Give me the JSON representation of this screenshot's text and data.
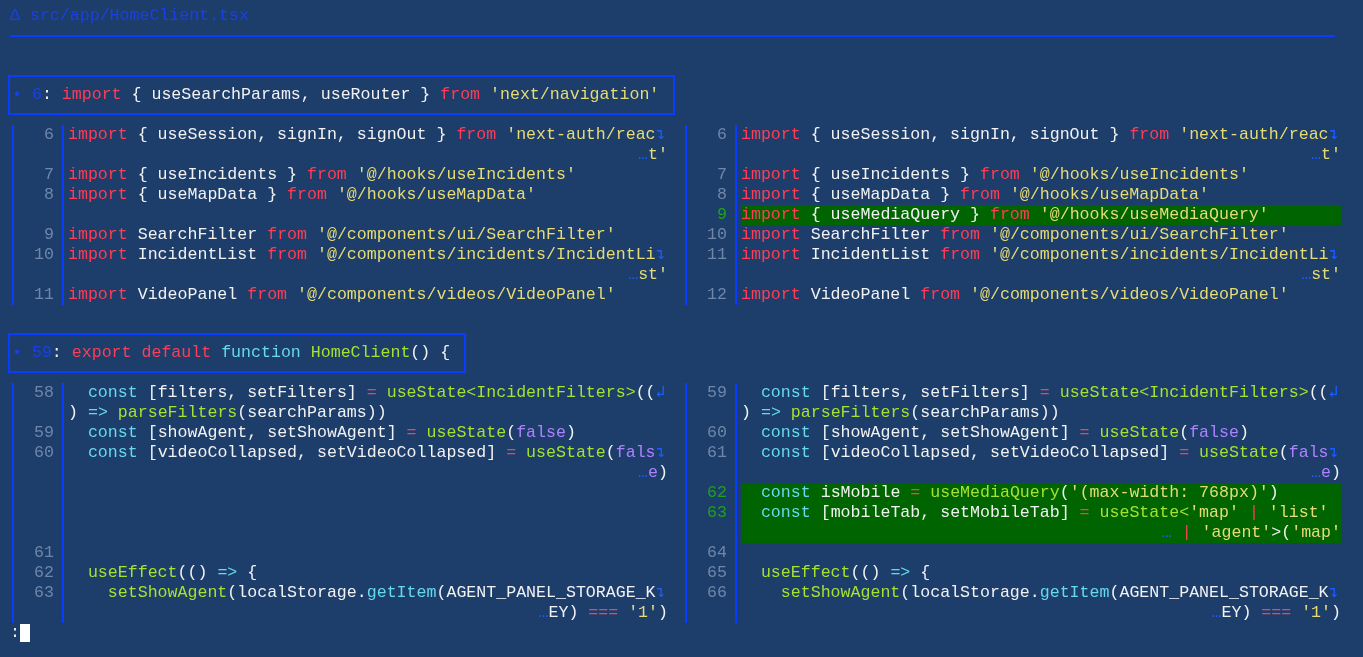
{
  "file_header": {
    "icon": "Δ",
    "path": "src/app/HomeClient.tsx"
  },
  "hunks": [
    {
      "header": {
        "bullet": "•",
        "line": "6",
        "sep": ":",
        "tokens": [
          {
            "kind": "kw",
            "text": "import"
          },
          {
            "kind": "plain",
            "text": " { useSearchParams, useRouter } "
          },
          {
            "kind": "kw",
            "text": "from"
          },
          {
            "kind": "str",
            "text": " 'next/navigation'"
          }
        ]
      },
      "left": [
        {
          "kind": "line",
          "num": "6",
          "added": false,
          "tokens": [
            {
              "kind": "kw",
              "text": "import"
            },
            {
              "kind": "plain",
              "text": " { useSession, signIn, signOut } "
            },
            {
              "kind": "kw",
              "text": "from"
            },
            {
              "kind": "str",
              "text": " 'next-auth/reac"
            },
            {
              "kind": "mark",
              "text": "↴"
            }
          ]
        },
        {
          "kind": "wrap",
          "right_aligned": true,
          "tokens": [
            {
              "kind": "mark",
              "text": "…"
            },
            {
              "kind": "str",
              "text": "t'"
            }
          ]
        },
        {
          "kind": "line",
          "num": "7",
          "added": false,
          "tokens": [
            {
              "kind": "kw",
              "text": "import"
            },
            {
              "kind": "plain",
              "text": " { useIncidents } "
            },
            {
              "kind": "kw",
              "text": "from"
            },
            {
              "kind": "str",
              "text": " '@/hooks/useIncidents'"
            }
          ]
        },
        {
          "kind": "line",
          "num": "8",
          "added": false,
          "tokens": [
            {
              "kind": "kw",
              "text": "import"
            },
            {
              "kind": "plain",
              "text": " { useMapData } "
            },
            {
              "kind": "kw",
              "text": "from"
            },
            {
              "kind": "str",
              "text": " '@/hooks/useMapData'"
            }
          ]
        },
        {
          "kind": "filler"
        },
        {
          "kind": "line",
          "num": "9",
          "added": false,
          "tokens": [
            {
              "kind": "kw",
              "text": "import"
            },
            {
              "kind": "plain",
              "text": " SearchFilter "
            },
            {
              "kind": "kw",
              "text": "from"
            },
            {
              "kind": "str",
              "text": " '@/components/ui/SearchFilter'"
            }
          ]
        },
        {
          "kind": "line",
          "num": "10",
          "added": false,
          "tokens": [
            {
              "kind": "kw",
              "text": "import"
            },
            {
              "kind": "plain",
              "text": " IncidentList "
            },
            {
              "kind": "kw",
              "text": "from"
            },
            {
              "kind": "str",
              "text": " '@/components/incidents/IncidentLi"
            },
            {
              "kind": "mark",
              "text": "↴"
            }
          ]
        },
        {
          "kind": "wrap",
          "right_aligned": true,
          "tokens": [
            {
              "kind": "mark",
              "text": "…"
            },
            {
              "kind": "str",
              "text": "st'"
            }
          ]
        },
        {
          "kind": "line",
          "num": "11",
          "added": false,
          "tokens": [
            {
              "kind": "kw",
              "text": "import"
            },
            {
              "kind": "plain",
              "text": " VideoPanel "
            },
            {
              "kind": "kw",
              "text": "from"
            },
            {
              "kind": "str",
              "text": " '@/components/videos/VideoPanel'"
            }
          ]
        }
      ],
      "right": [
        {
          "kind": "line",
          "num": "6",
          "added": false,
          "tokens": [
            {
              "kind": "kw",
              "text": "import"
            },
            {
              "kind": "plain",
              "text": " { useSession, signIn, signOut } "
            },
            {
              "kind": "kw",
              "text": "from"
            },
            {
              "kind": "str",
              "text": " 'next-auth/reac"
            },
            {
              "kind": "mark",
              "text": "↴"
            }
          ]
        },
        {
          "kind": "wrap",
          "right_aligned": true,
          "tokens": [
            {
              "kind": "mark",
              "text": "…"
            },
            {
              "kind": "str",
              "text": "t'"
            }
          ]
        },
        {
          "kind": "line",
          "num": "7",
          "added": false,
          "tokens": [
            {
              "kind": "kw",
              "text": "import"
            },
            {
              "kind": "plain",
              "text": " { useIncidents } "
            },
            {
              "kind": "kw",
              "text": "from"
            },
            {
              "kind": "str",
              "text": " '@/hooks/useIncidents'"
            }
          ]
        },
        {
          "kind": "line",
          "num": "8",
          "added": false,
          "tokens": [
            {
              "kind": "kw",
              "text": "import"
            },
            {
              "kind": "plain",
              "text": " { useMapData } "
            },
            {
              "kind": "kw",
              "text": "from"
            },
            {
              "kind": "str",
              "text": " '@/hooks/useMapData'"
            }
          ]
        },
        {
          "kind": "line",
          "num": "9",
          "added": true,
          "tokens": [
            {
              "kind": "kw",
              "text": "import"
            },
            {
              "kind": "plain",
              "text": " { useMediaQuery } "
            },
            {
              "kind": "kw",
              "text": "from"
            },
            {
              "kind": "str",
              "text": " '@/hooks/useMediaQuery'"
            }
          ]
        },
        {
          "kind": "line",
          "num": "10",
          "added": false,
          "tokens": [
            {
              "kind": "kw",
              "text": "import"
            },
            {
              "kind": "plain",
              "text": " SearchFilter "
            },
            {
              "kind": "kw",
              "text": "from"
            },
            {
              "kind": "str",
              "text": " '@/components/ui/SearchFilter'"
            }
          ]
        },
        {
          "kind": "line",
          "num": "11",
          "added": false,
          "tokens": [
            {
              "kind": "kw",
              "text": "import"
            },
            {
              "kind": "plain",
              "text": " IncidentList "
            },
            {
              "kind": "kw",
              "text": "from"
            },
            {
              "kind": "str",
              "text": " '@/components/incidents/IncidentLi"
            },
            {
              "kind": "mark",
              "text": "↴"
            }
          ]
        },
        {
          "kind": "wrap",
          "right_aligned": true,
          "tokens": [
            {
              "kind": "mark",
              "text": "…"
            },
            {
              "kind": "str",
              "text": "st'"
            }
          ]
        },
        {
          "kind": "line",
          "num": "12",
          "added": false,
          "tokens": [
            {
              "kind": "kw",
              "text": "import"
            },
            {
              "kind": "plain",
              "text": " VideoPanel "
            },
            {
              "kind": "kw",
              "text": "from"
            },
            {
              "kind": "str",
              "text": " '@/components/videos/VideoPanel'"
            }
          ]
        }
      ]
    },
    {
      "header": {
        "bullet": "•",
        "line": "59",
        "sep": ":",
        "tokens": [
          {
            "kind": "kw",
            "text": "export default"
          },
          {
            "kind": "storage",
            "text": " function"
          },
          {
            "kind": "fn",
            "text": " HomeClient"
          },
          {
            "kind": "plain",
            "text": "() {"
          }
        ]
      },
      "left": [
        {
          "kind": "line",
          "num": "58",
          "added": false,
          "tokens": [
            {
              "kind": "storage",
              "text": "  const"
            },
            {
              "kind": "plain",
              "text": " [filters, setFilters] "
            },
            {
              "kind": "kw",
              "text": "="
            },
            {
              "kind": "fn",
              "text": " useState<IncidentFilters>"
            },
            {
              "kind": "plain",
              "text": "(("
            },
            {
              "kind": "mark",
              "text": "↲"
            }
          ]
        },
        {
          "kind": "wrap",
          "right_aligned": false,
          "tokens": [
            {
              "kind": "plain",
              "text": ") "
            },
            {
              "kind": "storage",
              "text": "=>"
            },
            {
              "kind": "fn",
              "text": " parseFilters"
            },
            {
              "kind": "plain",
              "text": "(searchParams))"
            }
          ]
        },
        {
          "kind": "line",
          "num": "59",
          "added": false,
          "tokens": [
            {
              "kind": "storage",
              "text": "  const"
            },
            {
              "kind": "plain",
              "text": " [showAgent, setShowAgent] "
            },
            {
              "kind": "kw",
              "text": "="
            },
            {
              "kind": "fn",
              "text": " useState"
            },
            {
              "kind": "plain",
              "text": "("
            },
            {
              "kind": "bool",
              "text": "false"
            },
            {
              "kind": "plain",
              "text": ")"
            }
          ]
        },
        {
          "kind": "line",
          "num": "60",
          "added": false,
          "tokens": [
            {
              "kind": "storage",
              "text": "  const"
            },
            {
              "kind": "plain",
              "text": " [videoCollapsed, setVideoCollapsed] "
            },
            {
              "kind": "kw",
              "text": "="
            },
            {
              "kind": "fn",
              "text": " useState"
            },
            {
              "kind": "plain",
              "text": "("
            },
            {
              "kind": "bool",
              "text": "fals"
            },
            {
              "kind": "mark",
              "text": "↴"
            }
          ]
        },
        {
          "kind": "wrap",
          "right_aligned": true,
          "tokens": [
            {
              "kind": "mark",
              "text": "…"
            },
            {
              "kind": "bool",
              "text": "e"
            },
            {
              "kind": "plain",
              "text": ")"
            }
          ]
        },
        {
          "kind": "filler"
        },
        {
          "kind": "filler"
        },
        {
          "kind": "filler"
        },
        {
          "kind": "line",
          "num": "61",
          "added": false
        },
        {
          "kind": "line",
          "num": "62",
          "added": false,
          "tokens": [
            {
              "kind": "fn",
              "text": "  useEffect"
            },
            {
              "kind": "plain",
              "text": "(() "
            },
            {
              "kind": "storage",
              "text": "=>"
            },
            {
              "kind": "plain",
              "text": " {"
            }
          ]
        },
        {
          "kind": "line",
          "num": "63",
          "added": false,
          "tokens": [
            {
              "kind": "fn",
              "text": "    setShowAgent"
            },
            {
              "kind": "plain",
              "text": "(localStorage."
            },
            {
              "kind": "storage",
              "text": "getItem"
            },
            {
              "kind": "plain",
              "text": "(AGENT_PANEL_STORAGE_K"
            },
            {
              "kind": "mark",
              "text": "↴"
            }
          ]
        },
        {
          "kind": "wrap",
          "right_aligned": true,
          "tokens": [
            {
              "kind": "mark",
              "text": "…"
            },
            {
              "kind": "plain",
              "text": "EY) "
            },
            {
              "kind": "kw",
              "text": "==="
            },
            {
              "kind": "str",
              "text": " '1'"
            },
            {
              "kind": "plain",
              "text": ")"
            }
          ]
        }
      ],
      "right": [
        {
          "kind": "line",
          "num": "59",
          "added": false,
          "tokens": [
            {
              "kind": "storage",
              "text": "  const"
            },
            {
              "kind": "plain",
              "text": " [filters, setFilters] "
            },
            {
              "kind": "kw",
              "text": "="
            },
            {
              "kind": "fn",
              "text": " useState<IncidentFilters>"
            },
            {
              "kind": "plain",
              "text": "(("
            },
            {
              "kind": "mark",
              "text": "↲"
            }
          ]
        },
        {
          "kind": "wrap",
          "right_aligned": false,
          "tokens": [
            {
              "kind": "plain",
              "text": ") "
            },
            {
              "kind": "storage",
              "text": "=>"
            },
            {
              "kind": "fn",
              "text": " parseFilters"
            },
            {
              "kind": "plain",
              "text": "(searchParams))"
            }
          ]
        },
        {
          "kind": "line",
          "num": "60",
          "added": false,
          "tokens": [
            {
              "kind": "storage",
              "text": "  const"
            },
            {
              "kind": "plain",
              "text": " [showAgent, setShowAgent] "
            },
            {
              "kind": "kw",
              "text": "="
            },
            {
              "kind": "fn",
              "text": " useState"
            },
            {
              "kind": "plain",
              "text": "("
            },
            {
              "kind": "bool",
              "text": "false"
            },
            {
              "kind": "plain",
              "text": ")"
            }
          ]
        },
        {
          "kind": "line",
          "num": "61",
          "added": false,
          "tokens": [
            {
              "kind": "storage",
              "text": "  const"
            },
            {
              "kind": "plain",
              "text": " [videoCollapsed, setVideoCollapsed] "
            },
            {
              "kind": "kw",
              "text": "="
            },
            {
              "kind": "fn",
              "text": " useState"
            },
            {
              "kind": "plain",
              "text": "("
            },
            {
              "kind": "bool",
              "text": "fals"
            },
            {
              "kind": "mark",
              "text": "↴"
            }
          ]
        },
        {
          "kind": "wrap",
          "right_aligned": true,
          "tokens": [
            {
              "kind": "mark",
              "text": "…"
            },
            {
              "kind": "bool",
              "text": "e"
            },
            {
              "kind": "plain",
              "text": ")"
            }
          ]
        },
        {
          "kind": "line",
          "num": "62",
          "added": true,
          "tokens": [
            {
              "kind": "storage",
              "text": "  const"
            },
            {
              "kind": "plain",
              "text": " isMobile "
            },
            {
              "kind": "kw",
              "text": "="
            },
            {
              "kind": "fn",
              "text": " useMediaQuery"
            },
            {
              "kind": "plain",
              "text": "("
            },
            {
              "kind": "str",
              "text": "'(max-width: 768px)'"
            },
            {
              "kind": "plain",
              "text": ")"
            }
          ]
        },
        {
          "kind": "line",
          "num": "63",
          "added": true,
          "tokens": [
            {
              "kind": "storage",
              "text": "  const"
            },
            {
              "kind": "plain",
              "text": " [mobileTab, setMobileTab] "
            },
            {
              "kind": "kw",
              "text": "="
            },
            {
              "kind": "fn",
              "text": " useState<"
            },
            {
              "kind": "str",
              "text": "'map'"
            },
            {
              "kind": "kw",
              "text": " | "
            },
            {
              "kind": "str",
              "text": "'list'"
            }
          ]
        },
        {
          "kind": "wrap",
          "right_aligned": true,
          "added": true,
          "tokens": [
            {
              "kind": "mark",
              "text": "…"
            },
            {
              "kind": "kw",
              "text": " | "
            },
            {
              "kind": "str",
              "text": "'agent'"
            },
            {
              "kind": "plain",
              "text": ">("
            },
            {
              "kind": "str",
              "text": "'map'"
            }
          ]
        },
        {
          "kind": "line",
          "num": "64",
          "added": false
        },
        {
          "kind": "line",
          "num": "65",
          "added": false,
          "tokens": [
            {
              "kind": "fn",
              "text": "  useEffect"
            },
            {
              "kind": "plain",
              "text": "(() "
            },
            {
              "kind": "storage",
              "text": "=>"
            },
            {
              "kind": "plain",
              "text": " {"
            }
          ]
        },
        {
          "kind": "line",
          "num": "66",
          "added": false,
          "tokens": [
            {
              "kind": "fn",
              "text": "    setShowAgent"
            },
            {
              "kind": "plain",
              "text": "(localStorage."
            },
            {
              "kind": "storage",
              "text": "getItem"
            },
            {
              "kind": "plain",
              "text": "(AGENT_PANEL_STORAGE_K"
            },
            {
              "kind": "mark",
              "text": "↴"
            }
          ]
        },
        {
          "kind": "wrap",
          "right_aligned": true,
          "tokens": [
            {
              "kind": "mark",
              "text": "…"
            },
            {
              "kind": "plain",
              "text": "EY) "
            },
            {
              "kind": "kw",
              "text": "==="
            },
            {
              "kind": "str",
              "text": " '1'"
            },
            {
              "kind": "plain",
              "text": ")"
            }
          ]
        }
      ]
    }
  ],
  "prompt": ":"
}
